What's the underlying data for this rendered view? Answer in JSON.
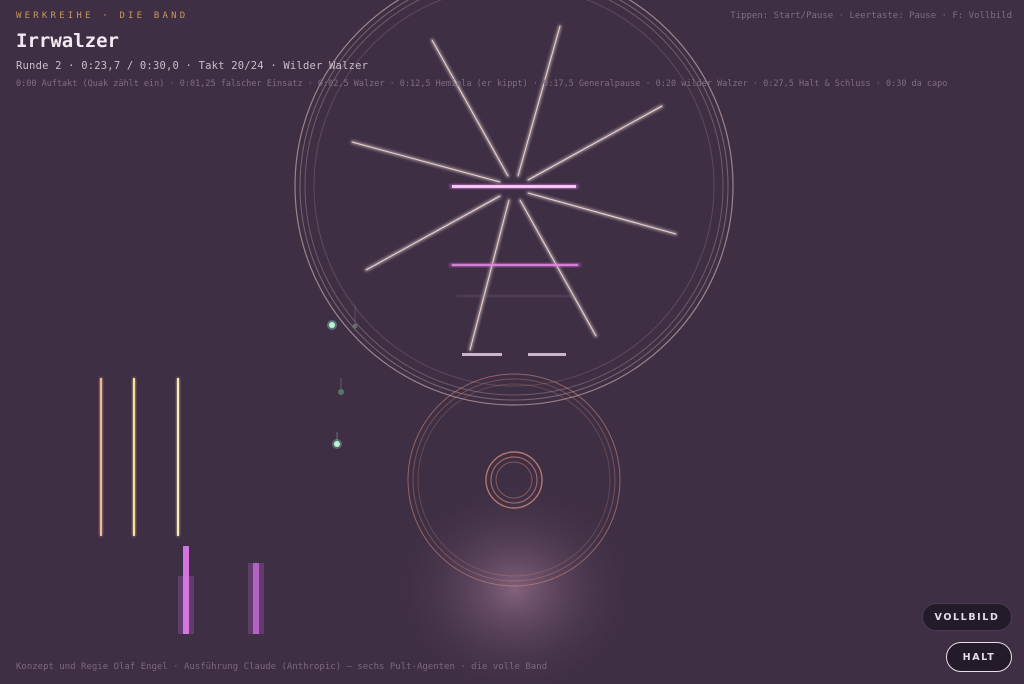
{
  "header": {
    "series": "WERKREIHE · DIE BAND",
    "title": "Irrwalzer",
    "status": "Runde 2 · 0:23,7 / 0:30,0 · Takt 20/24 · Wilder Walzer",
    "timeline": "0:00 Auftakt (Quak zählt ein) · 0:01,25 falscher Einsatz · 0:02,5 Walzer · 0:12,5 Hemiola (er kippt) · 0:17,5 Generalpause · 0:20 wilder Walzer · 0:27,5 Halt & Schluss · 0:30 da capo",
    "hint": "Tippen: Start/Pause · Leertaste: Pause · F: Vollbild"
  },
  "controls": {
    "fullscreen_label": "VOLLBILD",
    "halt_label": "HALT"
  },
  "footer": {
    "credits": "Konzept und Regie Olaf Engel · Ausführung Claude (Anthropic) — sechs Pult-Agenten · die volle Band"
  },
  "colors": {
    "background": "#3f2f45",
    "accent_gold": "#c9975a",
    "ring": "#e9c9c4",
    "spoke": "#f4e0d8",
    "magenta": "#e27df0",
    "peach": "#f0b894",
    "yellow": "#f6e39a",
    "green": "#9ff0c8"
  }
}
